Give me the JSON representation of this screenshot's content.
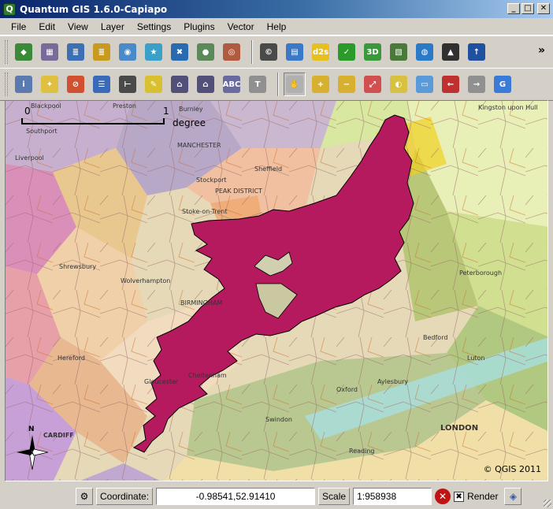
{
  "window": {
    "title": "Quantum GIS 1.6.0-Capiapo",
    "app_icon_letter": "Q",
    "controls": {
      "minimize": "_",
      "maximize": "□",
      "close": "✕"
    }
  },
  "menu": [
    "File",
    "Edit",
    "View",
    "Layer",
    "Settings",
    "Plugins",
    "Vector",
    "Help"
  ],
  "toolbar_overflow": "»",
  "toolbar1": [
    {
      "name": "add-wms-layer-icon",
      "color": "#3a8a3a",
      "glyph": "◆"
    },
    {
      "name": "add-raster-layer-icon",
      "color": "#7a6a9a",
      "glyph": "▦"
    },
    {
      "name": "add-postgis-layer-icon",
      "color": "#3c6fb4",
      "glyph": "≣"
    },
    {
      "name": "add-spatialite-layer-icon",
      "color": "#c89a20",
      "glyph": "≣"
    },
    {
      "name": "add-wfs-layer-icon",
      "color": "#4a8ac8",
      "glyph": "◉"
    },
    {
      "name": "new-vector-layer-icon",
      "color": "#3aa0c8",
      "glyph": "★"
    },
    {
      "name": "remove-layer-icon",
      "color": "#2a6ab0",
      "glyph": "✖"
    },
    {
      "name": "add-oracle-layer-icon",
      "color": "#5a8a5a",
      "glyph": "●"
    },
    {
      "name": "add-gps-layer-icon",
      "color": "#b05a40",
      "glyph": "◎"
    },
    {
      "sep": true
    },
    {
      "name": "copyright-label-icon",
      "color": "#4a4a4a",
      "glyph": "©"
    },
    {
      "name": "save-as-icon",
      "color": "#3a78c8",
      "glyph": "▤"
    },
    {
      "name": "d2s-icon",
      "color": "#e6c020",
      "glyph": "d2s"
    },
    {
      "name": "gps-tools-icon",
      "color": "#2a9a2a",
      "glyph": "✓"
    },
    {
      "name": "3d-viewer-icon",
      "color": "#3a9a3a",
      "glyph": "3D"
    },
    {
      "name": "georeferencer-icon",
      "color": "#4a7a3a",
      "glyph": "▧"
    },
    {
      "name": "globe-icon",
      "color": "#2a7ac8",
      "glyph": "◍"
    },
    {
      "name": "histogram-icon",
      "color": "#303030",
      "glyph": "▲"
    },
    {
      "name": "north-arrow-icon",
      "color": "#2050a0",
      "glyph": "↑"
    }
  ],
  "toolbar2": [
    {
      "name": "identify-icon",
      "color": "#5a7ab0",
      "glyph": "i"
    },
    {
      "name": "select-features-icon",
      "color": "#e0c040",
      "glyph": "✦"
    },
    {
      "name": "deselect-features-icon",
      "color": "#d05030",
      "glyph": "⊘"
    },
    {
      "name": "attribute-table-icon",
      "color": "#3a6ab8",
      "glyph": "☰"
    },
    {
      "name": "measure-line-icon",
      "color": "#4a4a4a",
      "glyph": "⊢"
    },
    {
      "name": "map-tips-icon",
      "color": "#d8c030",
      "glyph": "✎"
    },
    {
      "name": "new-bookmark-icon",
      "color": "#505078",
      "glyph": "⌂"
    },
    {
      "name": "show-bookmarks-icon",
      "color": "#505078",
      "glyph": "⌂"
    },
    {
      "name": "label-icon",
      "color": "#6a6aa0",
      "glyph": "ABC"
    },
    {
      "name": "annotation-icon",
      "color": "#909090",
      "glyph": "T"
    },
    {
      "sep": true
    },
    {
      "name": "pan-icon",
      "color": "#b0b0b0",
      "glyph": "✋",
      "active": true
    },
    {
      "name": "zoom-in-icon",
      "color": "#d8b030",
      "glyph": "+"
    },
    {
      "name": "zoom-out-icon",
      "color": "#d8b030",
      "glyph": "−"
    },
    {
      "name": "zoom-full-icon",
      "color": "#d05050",
      "glyph": "⤢"
    },
    {
      "name": "zoom-to-selection-icon",
      "color": "#d8c040",
      "glyph": "◐"
    },
    {
      "name": "zoom-to-layer-icon",
      "color": "#5a9ad8",
      "glyph": "▭"
    },
    {
      "name": "zoom-last-icon",
      "color": "#c03030",
      "glyph": "←"
    },
    {
      "name": "zoom-next-icon",
      "color": "#909090",
      "glyph": "→"
    },
    {
      "name": "refresh-icon",
      "color": "#3a7ad8",
      "glyph": "G"
    }
  ],
  "map": {
    "scalebar": {
      "left_label": "0",
      "right_label": "1",
      "unit": "degree"
    },
    "copyright": "© QGIS 2011",
    "north_label": "N",
    "place_labels": [
      "Blackpool",
      "Preston",
      "Burnley",
      "Kingston upon Hull",
      "Southport",
      "Liverpool",
      "MANCHESTER",
      "Sheffield",
      "Stockport",
      "PEAK DISTRICT",
      "Stoke-on-Trent",
      "Shrewsbury",
      "Wolverhampton",
      "BIRMINGHAM",
      "Peterborough",
      "Bedford",
      "Luton",
      "Oxford",
      "Aylesbury",
      "LONDON",
      "CARDIFF",
      "Hereford",
      "Gloucester",
      "Cheltenham",
      "Swindon",
      "Reading"
    ]
  },
  "statusbar": {
    "coordinate_label": "Coordinate:",
    "coordinate_value": "-0.98541,52.91410",
    "scale_label": "Scale",
    "scale_value": "1:958938",
    "render_label": "Render",
    "render_checked": "✖"
  }
}
